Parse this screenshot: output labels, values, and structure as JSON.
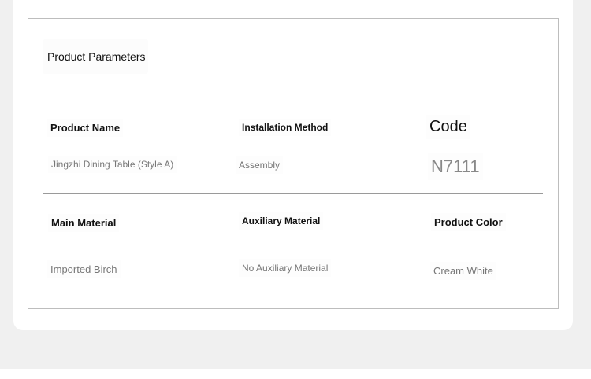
{
  "section": {
    "title": "Product Parameters"
  },
  "params_row1": [
    {
      "label": "Product Name",
      "value": "Jingzhi Dining Table (Style A)"
    },
    {
      "label": "Installation Method",
      "value": "Assembly"
    },
    {
      "label": "Code",
      "value": "N7111"
    }
  ],
  "params_row2": [
    {
      "label": "Main Material",
      "value": "Imported Birch"
    },
    {
      "label": "Auxiliary Material",
      "value": "No Auxiliary Material"
    },
    {
      "label": "Product Color",
      "value": "Cream White"
    }
  ]
}
